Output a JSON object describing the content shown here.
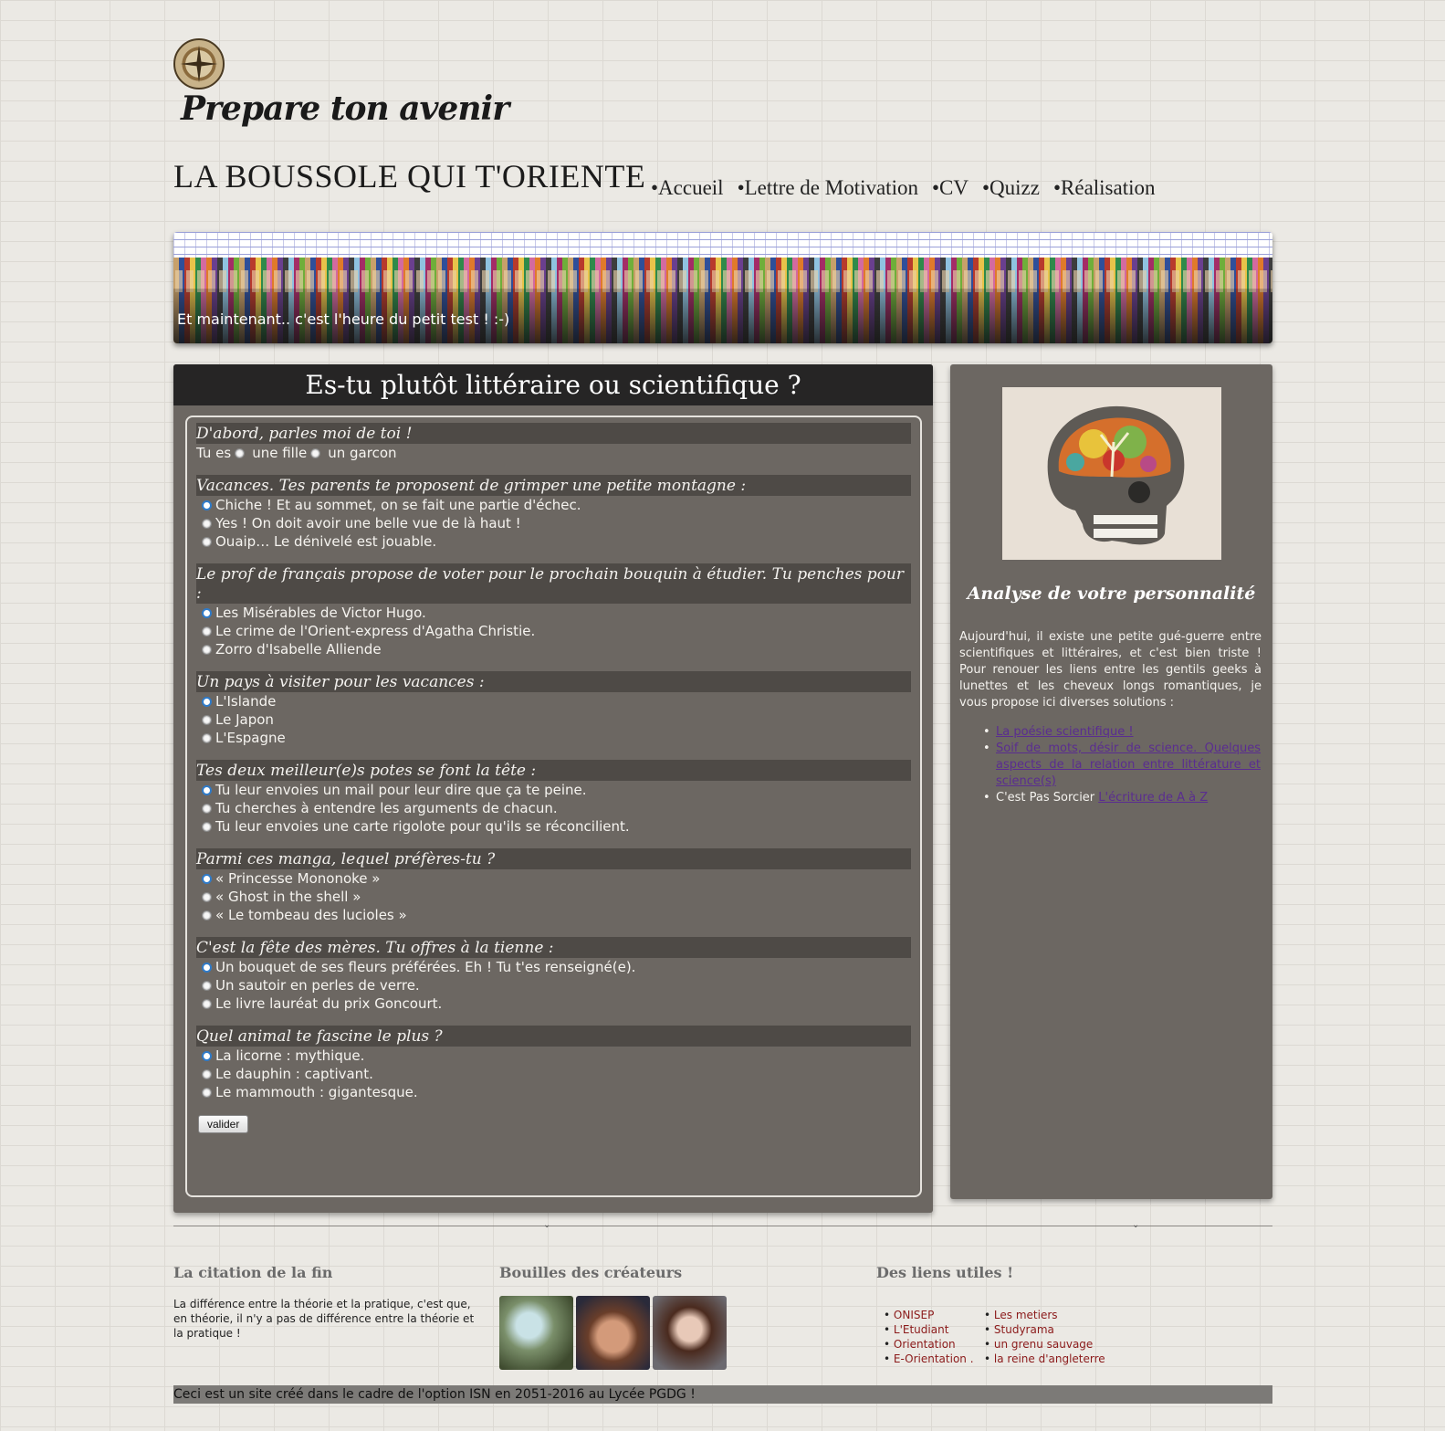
{
  "header": {
    "tagline": "Prepare ton avenir",
    "site_title": "LA BOUSSOLE QUI T'ORIENTE",
    "nav": [
      "•Accueil",
      "•Lettre de Motivation",
      "•CV",
      "•Quizz",
      "•Réalisation"
    ]
  },
  "banner": {
    "caption": "Et maintenant.. c'est l'heure du petit test ! :-)"
  },
  "quiz": {
    "title": "Es-tu plutôt littéraire ou scientifique ?",
    "intro": {
      "heading": "D'abord, parles moi de toi !",
      "label": "Tu es",
      "options": [
        "une fille",
        "un garcon"
      ]
    },
    "questions": [
      {
        "heading": "Vacances. Tes parents te proposent de grimper une petite montagne :",
        "options": [
          "Chiche ! Et au sommet, on se fait une partie d'échec.",
          "Yes ! On doit avoir une belle vue de là haut !",
          "Ouaip… Le dénivelé est jouable."
        ]
      },
      {
        "heading": "Le prof de français propose de voter pour le prochain bouquin à étudier. Tu penches pour :",
        "options": [
          "Les Misérables de Victor Hugo.",
          "Le crime de l'Orient-express d'Agatha Christie.",
          "Zorro d'Isabelle Alliende"
        ]
      },
      {
        "heading": "Un pays à visiter pour les vacances :",
        "options": [
          "L'Islande",
          "Le Japon",
          "L'Espagne"
        ]
      },
      {
        "heading": "Tes deux meilleur(e)s potes se font la tête :",
        "options": [
          "Tu leur envoies un mail pour leur dire que ça te peine.",
          "Tu cherches à entendre les arguments de chacun.",
          "Tu leur envoies une carte rigolote pour qu'ils se réconcilient."
        ]
      },
      {
        "heading": "Parmi ces manga, lequel préfères-tu ?",
        "options": [
          "« Princesse Mononoke »",
          "« Ghost in the shell »",
          "« Le tombeau des lucioles »"
        ]
      },
      {
        "heading": "C'est la fête des mères. Tu offres à la tienne :",
        "options": [
          "Un bouquet de ses fleurs préférées. Eh ! Tu t'es renseigné(e).",
          "Un sautoir en perles de verre.",
          "Le livre lauréat du prix Goncourt."
        ]
      },
      {
        "heading": "Quel animal te fascine le plus ?",
        "options": [
          "La licorne : mythique.",
          "Le dauphin : captivant.",
          "Le mammouth : gigantesque."
        ]
      }
    ],
    "submit_label": "valider"
  },
  "sidebar": {
    "title": "Analyse de votre personnalité",
    "text": "Aujourd'hui, il existe une petite gué-guerre entre scientifiques et littéraires, et c'est bien triste ! Pour renouer les liens entre les gentils geeks à lunettes et les cheveux longs romantiques, je vous propose ici diverses solutions :",
    "links": [
      {
        "prefix": "",
        "link": "La poésie scientifique !"
      },
      {
        "prefix": "",
        "link": "Soif de mots, désir de science. Quelques aspects de la relation entre littérature et science(s)"
      },
      {
        "prefix": "C'est Pas Sorcier ",
        "link": "L'écriture de A à Z"
      }
    ]
  },
  "footer": {
    "quote_title": "La citation de la fin",
    "quote": "La différence entre la théorie et la pratique, c'est que, en théorie, il n'y a pas de différence entre la théorie et la pratique !",
    "creators_title": "Bouilles des créateurs",
    "links_title": "Des liens utiles !",
    "links_col1": [
      "ONISEP",
      "L'Etudiant",
      "Orientation",
      "E-Orientation ."
    ],
    "links_col2": [
      "Les metiers",
      "Studyrama",
      "un grenu sauvage",
      "la reine d'angleterre"
    ],
    "bottom": "Ceci est un site créé dans le cadre de l'option ISN en 2051-2016 au Lycée PGDG !"
  }
}
